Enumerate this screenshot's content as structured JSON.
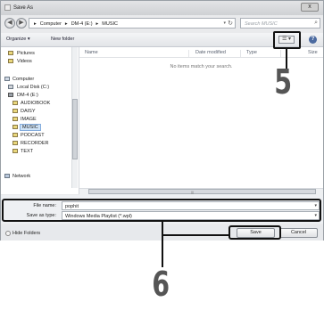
{
  "window": {
    "title": "Save As",
    "close_glyph": "x"
  },
  "address_bar": {
    "breadcrumbs": [
      "Computer",
      "DM-4 (E:)",
      "MUSIC"
    ],
    "separator": "▸",
    "search_placeholder": "Search MUSIC"
  },
  "toolbar": {
    "organize_label": "Organize ▾",
    "new_folder_label": "New folder",
    "view_glyph": "☰ ▾",
    "help_glyph": "?"
  },
  "sidebar": {
    "items": [
      {
        "label": "Pictures",
        "icon": "pictures-icon"
      },
      {
        "label": "Videos",
        "icon": "videos-icon"
      },
      {
        "label": "Computer",
        "icon": "computer-icon"
      },
      {
        "label": "Local Disk (C:)",
        "icon": "drive-icon"
      },
      {
        "label": "DM-4 (E:)",
        "icon": "drive-icon"
      },
      {
        "label": "AUDIOBOOK",
        "icon": "folder-icon"
      },
      {
        "label": "DAISY",
        "icon": "folder-icon"
      },
      {
        "label": "IMAGE",
        "icon": "folder-icon"
      },
      {
        "label": "MUSIC",
        "icon": "folder-icon",
        "selected": true
      },
      {
        "label": "PODCAST",
        "icon": "folder-icon"
      },
      {
        "label": "RECORDER",
        "icon": "folder-icon"
      },
      {
        "label": "TEXT",
        "icon": "folder-icon"
      },
      {
        "label": "Network",
        "icon": "network-icon"
      }
    ]
  },
  "file_list": {
    "columns": [
      "Name",
      "Date modified",
      "Type",
      "Size"
    ],
    "empty_message": "No items match your search."
  },
  "form": {
    "file_name_label": "File name:",
    "file_name_value": "pophit",
    "save_type_label": "Save as type:",
    "save_type_value": "Windows Media Playlist (*.wpl)"
  },
  "footer": {
    "hide_folders_label": "Hide Folders",
    "save_label": "Save",
    "cancel_label": "Cancel"
  },
  "annotations": {
    "callout_5": "5",
    "callout_6": "6"
  }
}
